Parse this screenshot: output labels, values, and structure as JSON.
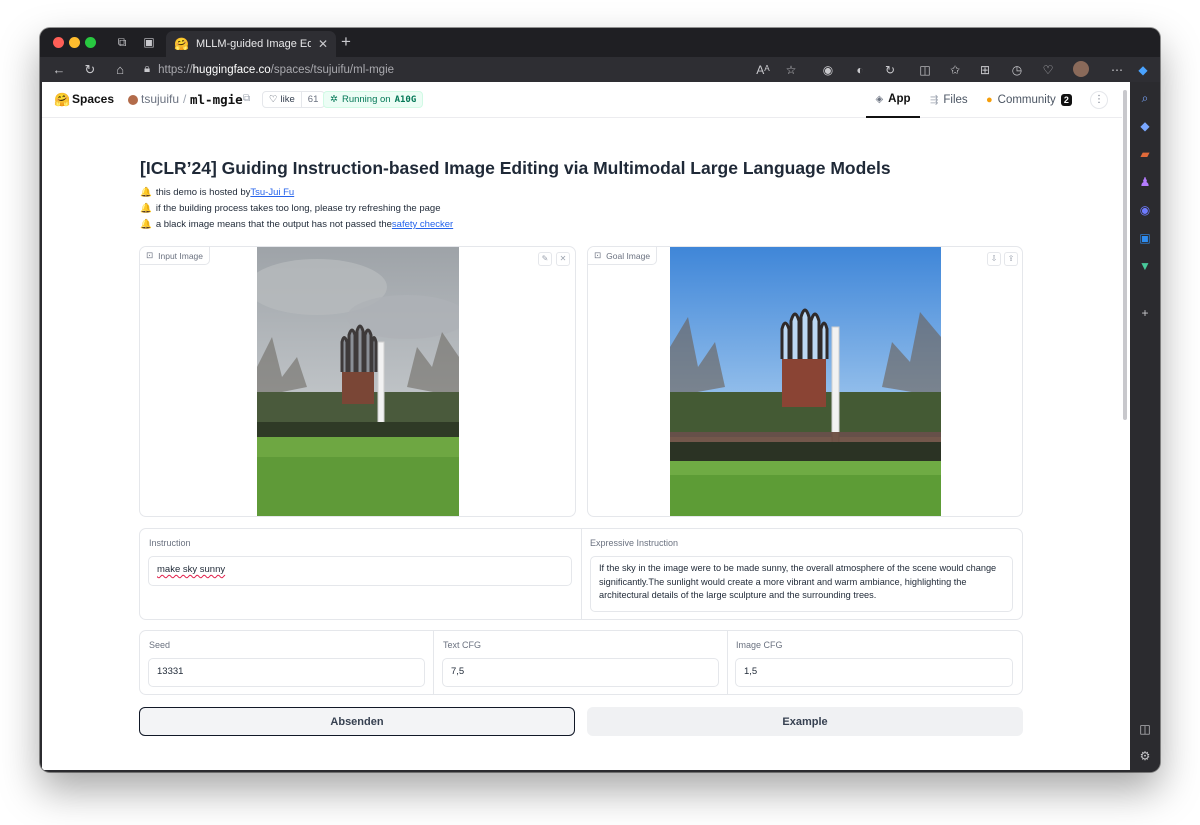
{
  "browser": {
    "tab_title": "MLLM-guided Image Editing (M",
    "url_scheme": "https://",
    "url_host": "huggingface.co",
    "url_path": "/spaces/tsujuifu/ml-mgie"
  },
  "hf_header": {
    "spaces_label": "Spaces",
    "owner": "tsujuifu",
    "separator": "/",
    "repo": "ml-mgie",
    "like_label": "like",
    "like_count": "61",
    "running_prefix": "Running on",
    "running_hw": "A10G",
    "tabs": [
      {
        "label": "App",
        "active": true
      },
      {
        "label": "Files",
        "active": false
      },
      {
        "label": "Community",
        "badge": "2",
        "active": false
      }
    ]
  },
  "content": {
    "title": "[ICLR’24] Guiding Instruction-based Image Editing via Multimodal Large Language Models",
    "notes": [
      {
        "text": "this demo is hosted by ",
        "link": "Tsu-Jui Fu"
      },
      {
        "text": "if the building process takes too long, please try refreshing the page",
        "link": ""
      },
      {
        "text": "a black image means that the output has not passed the ",
        "link": "safety checker"
      }
    ],
    "input_image_label": "Input Image",
    "goal_image_label": "Goal Image",
    "instruction_label": "Instruction",
    "instruction_value": "make sky sunny",
    "expressive_label": "Expressive Instruction",
    "expressive_value": "If the sky in the image were to be made sunny, the overall atmosphere of the scene would change significantly.The sunlight would create a more vibrant and warm ambiance, highlighting the architectural details of the large sculpture and the surrounding trees.",
    "seed_label": "Seed",
    "seed_value": "13331",
    "text_cfg_label": "Text CFG",
    "text_cfg_value": "7,5",
    "image_cfg_label": "Image CFG",
    "image_cfg_value": "1,5",
    "submit_label": "Absenden",
    "example_label": "Example"
  },
  "colors": {
    "accent_link": "#2563eb",
    "running_green": "#047857",
    "primary_border": "#111827"
  },
  "icons": [
    "hugging-face-icon",
    "bell-icon",
    "heart-icon",
    "copy-icon",
    "pencil-icon",
    "close-icon",
    "download-icon",
    "share-icon",
    "image-icon"
  ]
}
